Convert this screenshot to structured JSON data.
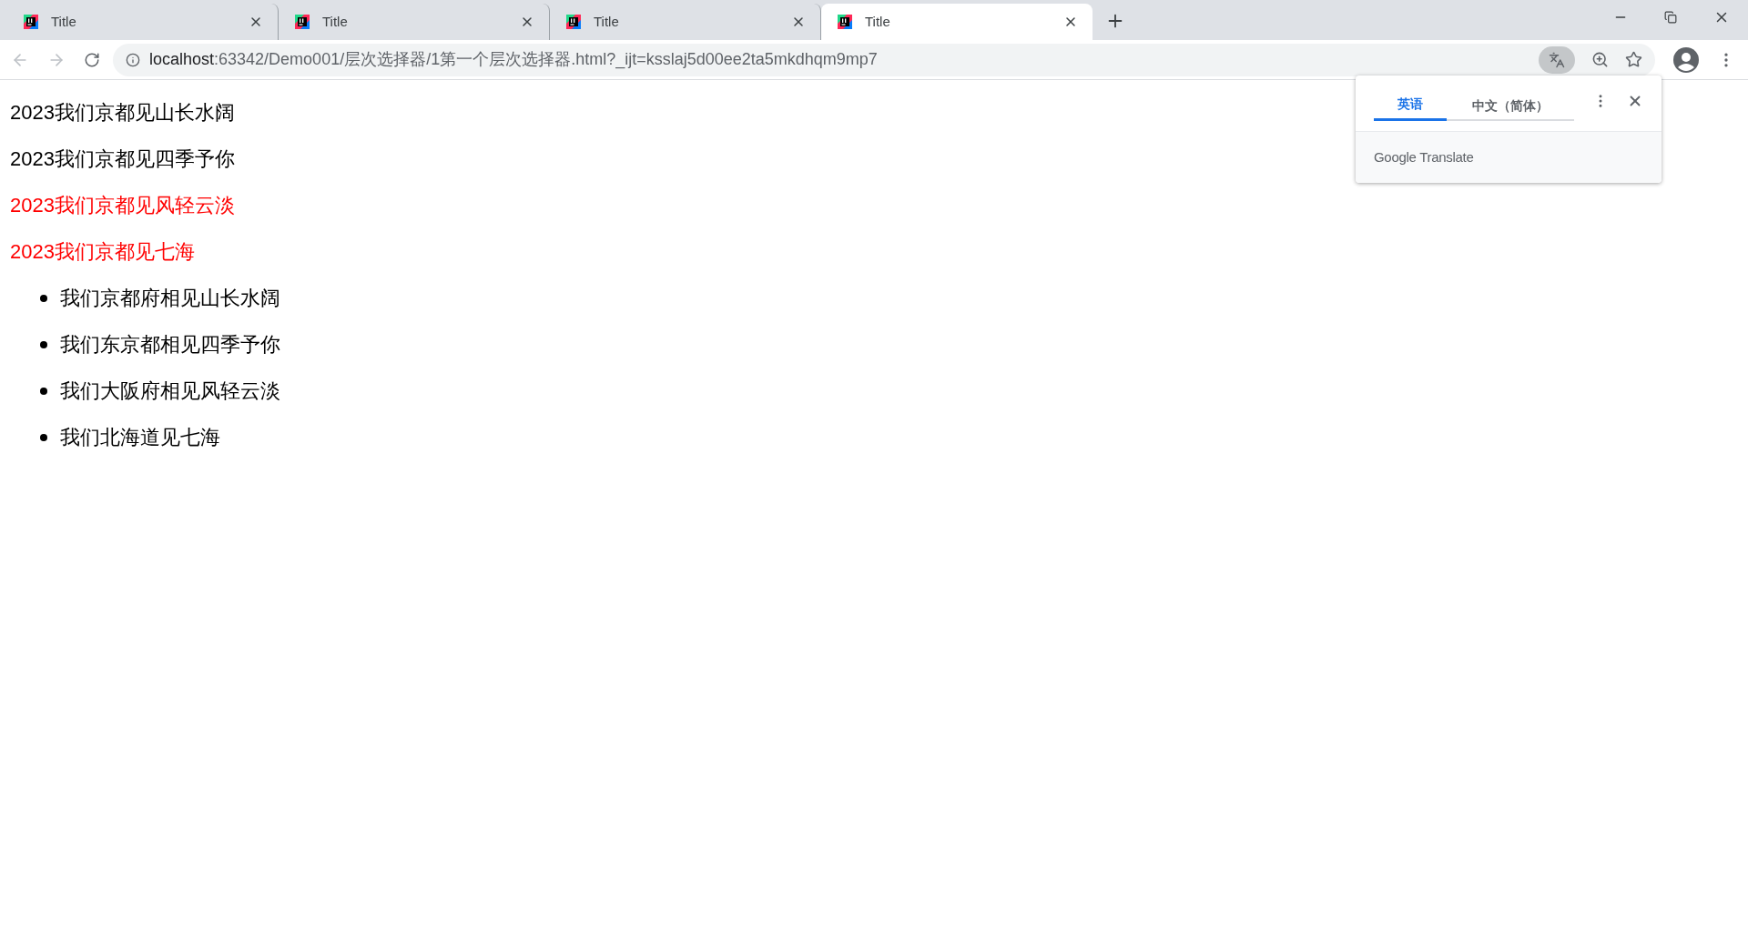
{
  "tabs": [
    {
      "title": "Title",
      "selected": false
    },
    {
      "title": "Title",
      "selected": false
    },
    {
      "title": "Title",
      "selected": false
    },
    {
      "title": "Title",
      "selected": true
    }
  ],
  "address": {
    "host": "localhost",
    "path": ":63342/Demo001/层次选择器/1第一个层次选择器.html?_ijt=ksslaj5d00ee2ta5mkdhqm9mp7"
  },
  "paragraphs": [
    {
      "text": "2023我们京都见山长水阔",
      "color": "#000000"
    },
    {
      "text": "2023我们京都见四季予你",
      "color": "#000000"
    },
    {
      "text": "2023我们京都见风轻云淡",
      "color": "#ff0000"
    },
    {
      "text": "2023我们京都见七海",
      "color": "#ff0000"
    }
  ],
  "list_items": [
    "我们京都府相见山长水阔",
    "我们东京都相见四季予你",
    "我们大阪府相见风轻云淡",
    "我们北海道见七海"
  ],
  "translate_popup": {
    "tabs": [
      {
        "label": "英语",
        "selected": true
      },
      {
        "label": "中文（简体）",
        "selected": false
      }
    ],
    "brand": "Google",
    "product": "Translate"
  }
}
